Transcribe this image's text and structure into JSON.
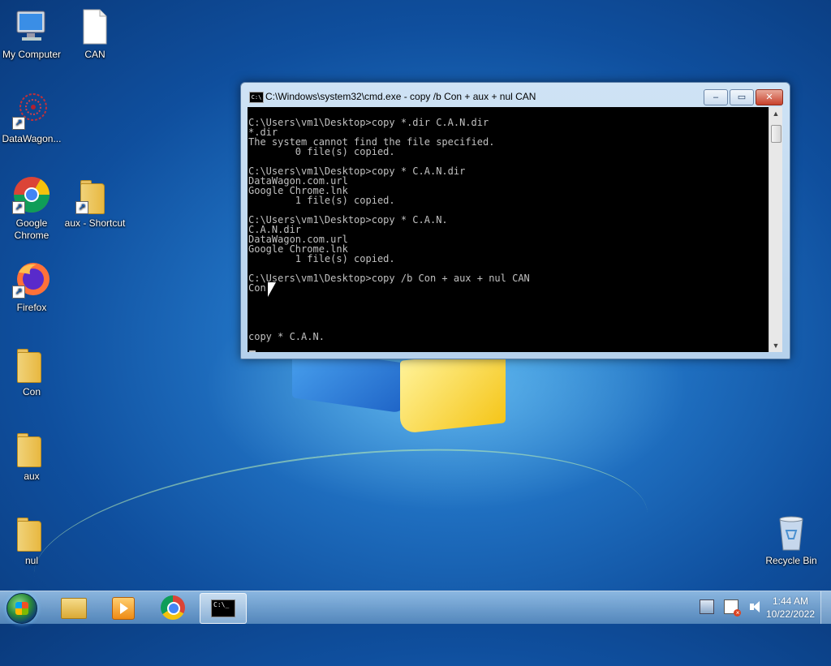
{
  "desktop": {
    "icons": [
      {
        "label": "My Computer"
      },
      {
        "label": "CAN"
      },
      {
        "label": "DataWagon..."
      },
      {
        "label": "Google Chrome"
      },
      {
        "label": "aux - Shortcut"
      },
      {
        "label": "Firefox"
      },
      {
        "label": "Con"
      },
      {
        "label": "aux"
      },
      {
        "label": "nul"
      },
      {
        "label": "Recycle Bin"
      }
    ]
  },
  "cmd_window": {
    "title": "C:\\Windows\\system32\\cmd.exe - copy  /b Con + aux + nul CAN",
    "icon_text": "C:\\",
    "minimize_label": "‒",
    "maximize_label": "▭",
    "close_label": "✕",
    "console_text": "C:\\Users\\vm1\\Desktop>copy *.dir C.A.N.dir\n*.dir\nThe system cannot find the file specified.\n        0 file(s) copied.\n\nC:\\Users\\vm1\\Desktop>copy * C.A.N.dir\nDataWagon.com.url\nGoogle Chrome.lnk\n        1 file(s) copied.\n\nC:\\Users\\vm1\\Desktop>copy * C.A.N.\nC.A.N.dir\nDataWagon.com.url\nGoogle Chrome.lnk\n        1 file(s) copied.\n\nC:\\Users\\vm1\\Desktop>copy /b Con + aux + nul CAN\nCon\n\n\n\n\ncopy * C.A.N."
  },
  "taskbar": {
    "cmd_icon_text": "C:\\_",
    "clock_time": "1:44 AM",
    "clock_date": "10/22/2022"
  }
}
